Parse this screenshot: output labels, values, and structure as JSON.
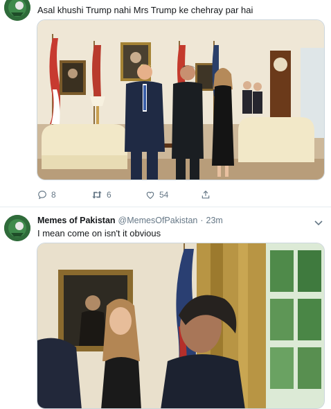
{
  "tweet1": {
    "text": "Asal khushi Trump nahi Mrs Trump ke chehray par hai",
    "actions": {
      "reply_count": "8",
      "retweet_count": "6",
      "like_count": "54"
    }
  },
  "tweet2": {
    "name": "Memes of Pakistan",
    "handle": "@MemesOfPakistan",
    "dot": "·",
    "time": "23m",
    "text": "I mean come on isn't it obvious"
  },
  "colors": {
    "secondary_text": "#657786",
    "border": "#e6ecf0",
    "avatar_bg": "#2f6b3a"
  },
  "icons": [
    "reply-icon",
    "retweet-icon",
    "like-icon",
    "share-icon",
    "chevron-down-icon"
  ]
}
